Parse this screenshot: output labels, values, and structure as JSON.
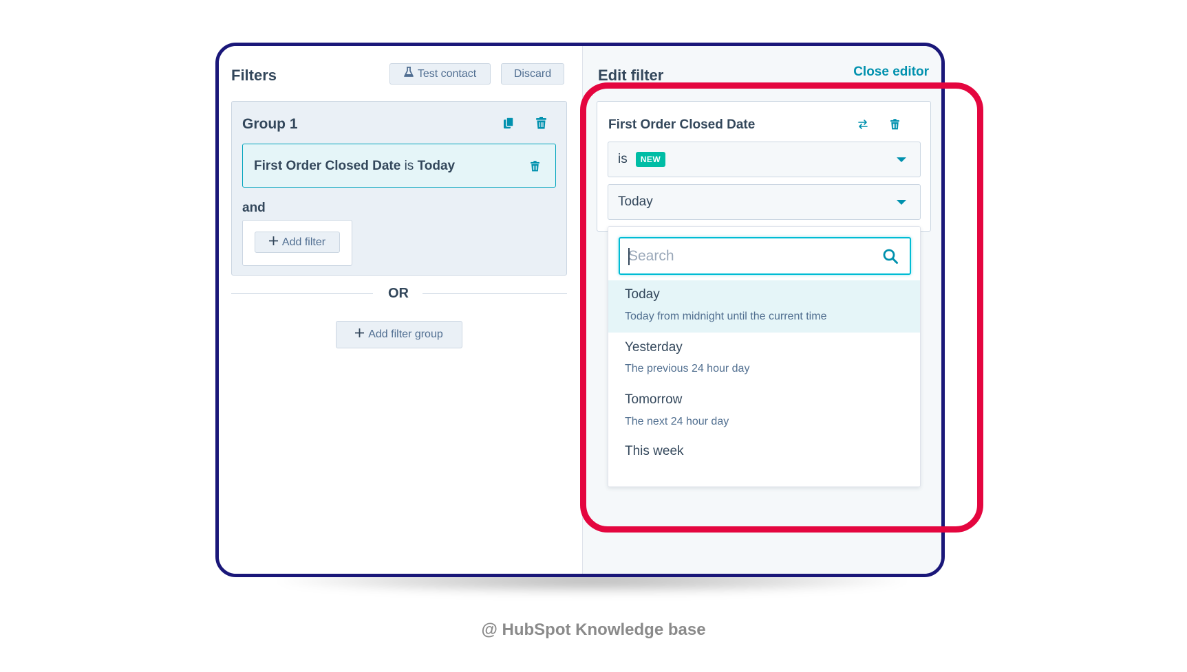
{
  "left_panel": {
    "title": "Filters",
    "test_contact_label": "Test contact",
    "discard_label": "Discard",
    "group": {
      "title": "Group 1",
      "filter": {
        "property": "First Order Closed Date",
        "operator": "is",
        "value": "Today"
      },
      "and_label": "and",
      "add_filter_label": "Add filter"
    },
    "or_label": "OR",
    "add_filter_group_label": "Add filter group"
  },
  "right_panel": {
    "title": "Edit filter",
    "close_editor_label": "Close editor",
    "property_name": "First Order Closed Date",
    "operator_value": "is",
    "new_badge": "NEW",
    "date_value": "Today",
    "search": {
      "placeholder": "Search",
      "value": ""
    },
    "options": [
      {
        "label": "Today",
        "description": "Today from midnight until the current time",
        "selected": true
      },
      {
        "label": "Yesterday",
        "description": "The previous 24 hour day",
        "selected": false
      },
      {
        "label": "Tomorrow",
        "description": "The next 24 hour day",
        "selected": false
      },
      {
        "label": "This week",
        "description": "",
        "selected": false
      }
    ]
  },
  "caption": "@ HubSpot Knowledge base",
  "colors": {
    "frame_border": "#1a1779",
    "highlight": "#e4063f",
    "accent": "#0091ae",
    "new_badge": "#00bda5"
  },
  "icons": [
    "flask-icon",
    "copy-icon",
    "trash-icon",
    "swap-icon",
    "caret-down-icon",
    "search-icon",
    "plus-icon"
  ]
}
